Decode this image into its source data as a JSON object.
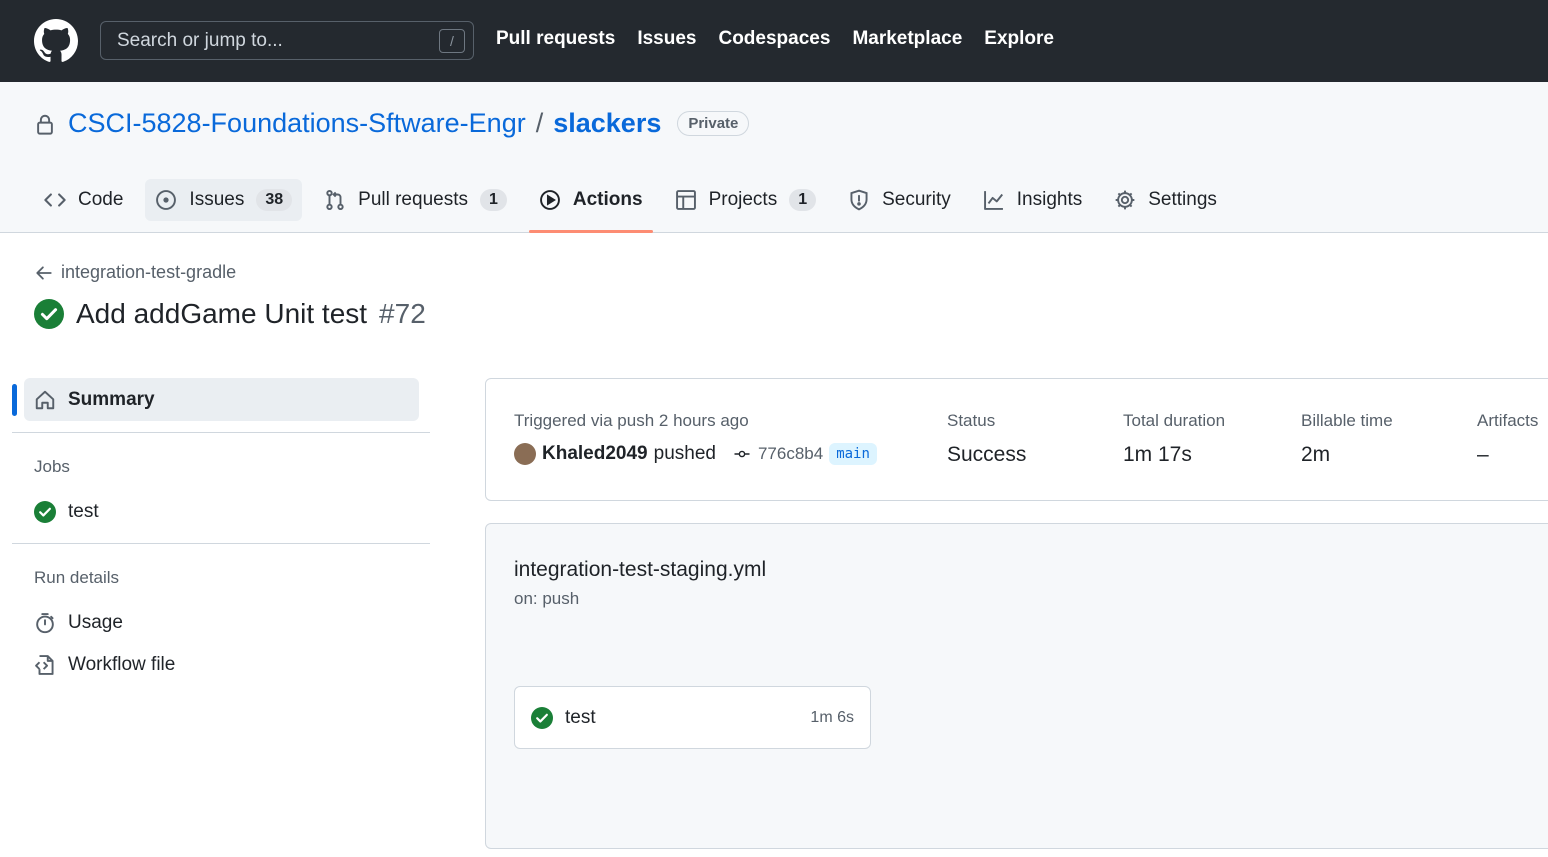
{
  "header": {
    "search_placeholder": "Search or jump to...",
    "search_shortcut": "/",
    "nav": [
      "Pull requests",
      "Issues",
      "Codespaces",
      "Marketplace",
      "Explore"
    ]
  },
  "repo": {
    "owner": "CSCI-5828-Foundations-Sftware-Engr",
    "separator": "/",
    "name": "slackers",
    "visibility": "Private"
  },
  "tabs": {
    "code": "Code",
    "issues": "Issues",
    "issues_count": "38",
    "pulls": "Pull requests",
    "pulls_count": "1",
    "actions": "Actions",
    "projects": "Projects",
    "projects_count": "1",
    "security": "Security",
    "insights": "Insights",
    "settings": "Settings"
  },
  "run": {
    "back_label": "integration-test-gradle",
    "title": "Add addGame Unit test",
    "number": "#72"
  },
  "sidebar": {
    "summary": "Summary",
    "jobs_heading": "Jobs",
    "job": "test",
    "run_details_heading": "Run details",
    "usage": "Usage",
    "workflow_file": "Workflow file"
  },
  "summary": {
    "trigger": "Triggered via push 2 hours ago",
    "actor": "Khaled2049",
    "action": "pushed",
    "sha": "776c8b4",
    "branch": "main",
    "status_label": "Status",
    "status_value": "Success",
    "duration_label": "Total duration",
    "duration_value": "1m 17s",
    "billable_label": "Billable time",
    "billable_value": "2m",
    "artifacts_label": "Artifacts",
    "artifacts_value": "–"
  },
  "workflow": {
    "file": "integration-test-staging.yml",
    "on": "on: push",
    "job_name": "test",
    "job_duration": "1m 6s"
  },
  "colors": {
    "header_bg": "#24292f",
    "link": "#0969da",
    "success": "#1a7f37",
    "active_tab_underline": "#fd8c73"
  }
}
